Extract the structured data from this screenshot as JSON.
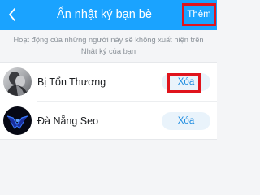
{
  "header": {
    "title": "Ẩn nhật ký bạn bè",
    "add_label": "Thêm"
  },
  "notice": "Hoạt động của những người này sẽ không xuất hiện trên Nhật ký của bạn",
  "friends": [
    {
      "name": "Bị Tổn Thương",
      "remove_label": "Xóa"
    },
    {
      "name": "Đà Nẵng Seo",
      "remove_label": "Xóa"
    }
  ],
  "colors": {
    "header_bg": "#1aa3ff",
    "highlight": "#e0141c",
    "remove_text": "#1d8ce0"
  },
  "icons": {
    "back": "chevron-left-icon"
  }
}
